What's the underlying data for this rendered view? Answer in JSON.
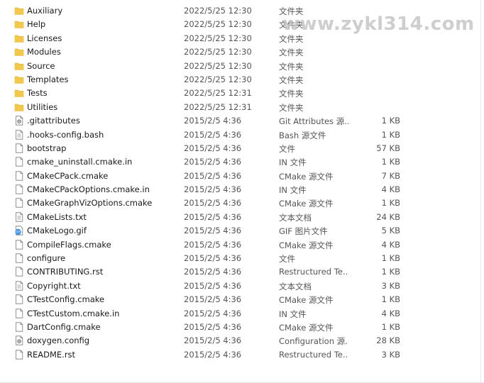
{
  "watermark": "www.zykl314.com",
  "colors": {
    "folder": "#f2c94c",
    "folder_dark": "#e0ad2a",
    "file_border": "#7a7a7a",
    "gif_blue": "#3a8ee6"
  },
  "files": [
    {
      "name": "Auxiliary",
      "date": "2022/5/25 12:30",
      "type": "文件夹",
      "size": "",
      "icon": "folder-icon"
    },
    {
      "name": "Help",
      "date": "2022/5/25 12:30",
      "type": "文件夹",
      "size": "",
      "icon": "folder-icon"
    },
    {
      "name": "Licenses",
      "date": "2022/5/25 12:30",
      "type": "文件夹",
      "size": "",
      "icon": "folder-icon"
    },
    {
      "name": "Modules",
      "date": "2022/5/25 12:30",
      "type": "文件夹",
      "size": "",
      "icon": "folder-icon"
    },
    {
      "name": "Source",
      "date": "2022/5/25 12:30",
      "type": "文件夹",
      "size": "",
      "icon": "folder-icon"
    },
    {
      "name": "Templates",
      "date": "2022/5/25 12:30",
      "type": "文件夹",
      "size": "",
      "icon": "folder-icon"
    },
    {
      "name": "Tests",
      "date": "2022/5/25 12:31",
      "type": "文件夹",
      "size": "",
      "icon": "folder-icon"
    },
    {
      "name": "Utilities",
      "date": "2022/5/25 12:31",
      "type": "文件夹",
      "size": "",
      "icon": "folder-icon"
    },
    {
      "name": ".gitattributes",
      "date": "2015/2/5 4:36",
      "type": "Git Attributes 源...",
      "size": "1 KB",
      "icon": "settings-file-icon"
    },
    {
      "name": ".hooks-config.bash",
      "date": "2015/2/5 4:36",
      "type": "Bash 源文件",
      "size": "1 KB",
      "icon": "script-file-icon"
    },
    {
      "name": "bootstrap",
      "date": "2015/2/5 4:36",
      "type": "文件",
      "size": "57 KB",
      "icon": "file-icon"
    },
    {
      "name": "cmake_uninstall.cmake.in",
      "date": "2015/2/5 4:36",
      "type": "IN 文件",
      "size": "1 KB",
      "icon": "file-icon"
    },
    {
      "name": "CMakeCPack.cmake",
      "date": "2015/2/5 4:36",
      "type": "CMake 源文件",
      "size": "7 KB",
      "icon": "file-icon"
    },
    {
      "name": "CMakeCPackOptions.cmake.in",
      "date": "2015/2/5 4:36",
      "type": "IN 文件",
      "size": "4 KB",
      "icon": "file-icon"
    },
    {
      "name": "CMakeGraphVizOptions.cmake",
      "date": "2015/2/5 4:36",
      "type": "CMake 源文件",
      "size": "1 KB",
      "icon": "file-icon"
    },
    {
      "name": "CMakeLists.txt",
      "date": "2015/2/5 4:36",
      "type": "文本文档",
      "size": "24 KB",
      "icon": "text-file-icon"
    },
    {
      "name": "CMakeLogo.gif",
      "date": "2015/2/5 4:36",
      "type": "GIF 图片文件",
      "size": "5 KB",
      "icon": "gif-image-icon"
    },
    {
      "name": "CompileFlags.cmake",
      "date": "2015/2/5 4:36",
      "type": "CMake 源文件",
      "size": "4 KB",
      "icon": "file-icon"
    },
    {
      "name": "configure",
      "date": "2015/2/5 4:36",
      "type": "文件",
      "size": "1 KB",
      "icon": "file-icon"
    },
    {
      "name": "CONTRIBUTING.rst",
      "date": "2015/2/5 4:36",
      "type": "Restructured Te...",
      "size": "1 KB",
      "icon": "file-icon"
    },
    {
      "name": "Copyright.txt",
      "date": "2015/2/5 4:36",
      "type": "文本文档",
      "size": "3 KB",
      "icon": "text-file-icon"
    },
    {
      "name": "CTestConfig.cmake",
      "date": "2015/2/5 4:36",
      "type": "CMake 源文件",
      "size": "1 KB",
      "icon": "file-icon"
    },
    {
      "name": "CTestCustom.cmake.in",
      "date": "2015/2/5 4:36",
      "type": "IN 文件",
      "size": "4 KB",
      "icon": "file-icon"
    },
    {
      "name": "DartConfig.cmake",
      "date": "2015/2/5 4:36",
      "type": "CMake 源文件",
      "size": "1 KB",
      "icon": "file-icon"
    },
    {
      "name": "doxygen.config",
      "date": "2015/2/5 4:36",
      "type": "Configuration 源...",
      "size": "28 KB",
      "icon": "settings-file-icon"
    },
    {
      "name": "README.rst",
      "date": "2015/2/5 4:36",
      "type": "Restructured Te...",
      "size": "3 KB",
      "icon": "file-icon"
    }
  ]
}
